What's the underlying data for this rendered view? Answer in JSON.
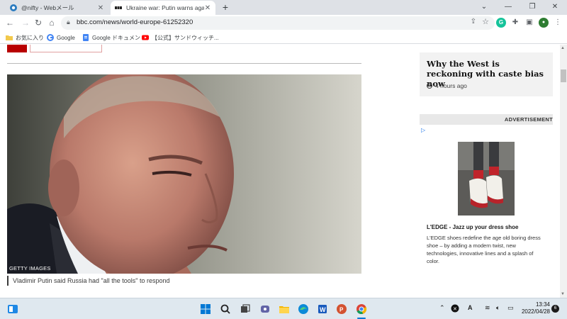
{
  "browser": {
    "tabs": [
      {
        "title": "@nifty - Webメール",
        "active": false
      },
      {
        "title": "Ukraine war: Putin warns against",
        "active": true
      }
    ],
    "new_tab_symbol": "+",
    "url": "bbc.com/news/world-europe-61252320"
  },
  "bookmarks": [
    {
      "label": "お気に入り",
      "icon": "folder-icon"
    },
    {
      "label": "Google",
      "icon": "google-icon"
    },
    {
      "label": "Google ドキュメント",
      "icon": "docs-icon"
    },
    {
      "label": "【公式】サンドウィッチ...",
      "icon": "youtube-icon"
    }
  ],
  "article": {
    "image_credit": "GETTY IMAGES",
    "caption": "Vladimir Putin said Russia had \"all the tools\" to respond"
  },
  "sidebar": {
    "related_title": "Why the West is reckoning with caste bias now",
    "related_time": "4 hours ago",
    "ad_label": "ADVERTISEMENT",
    "ad_title": "L'EDGE - Jazz up your dress shoe",
    "ad_text": "L'EDGE shoes redefine the age old boring dress shoe – by adding a modern twist, new technologies, innovative lines and a splash of color."
  },
  "taskbar": {
    "time": "13:34",
    "date": "2022/04/28",
    "notifications": "6"
  },
  "colors": {
    "bbc_red": "#b80000",
    "chrome_tabstrip": "#dee1e6",
    "taskbar_bg": "#dfe8ef"
  }
}
